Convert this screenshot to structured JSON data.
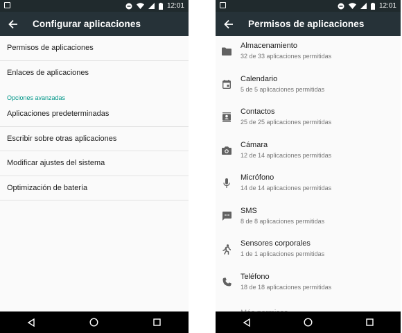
{
  "status": {
    "time": "12:01"
  },
  "left": {
    "title": "Configurar aplicaciones",
    "items_top": [
      {
        "label": "Permisos de aplicaciones"
      },
      {
        "label": "Enlaces de aplicaciones"
      }
    ],
    "section_header": "Opciones avanzadas",
    "items_adv": [
      {
        "label": "Aplicaciones predeterminadas"
      },
      {
        "label": "Escribir sobre otras aplicaciones"
      },
      {
        "label": "Modificar ajustes del sistema"
      },
      {
        "label": "Optimización de batería"
      }
    ]
  },
  "right": {
    "title": "Permisos de aplicaciones",
    "items": [
      {
        "name": "Almacenamiento",
        "sub": "32 de 33 aplicaciones permitidas",
        "icon": "folder-icon"
      },
      {
        "name": "Calendario",
        "sub": "5 de 5 aplicaciones permitidas",
        "icon": "calendar-icon"
      },
      {
        "name": "Contactos",
        "sub": "25 de 25 aplicaciones permitidas",
        "icon": "contacts-icon"
      },
      {
        "name": "Cámara",
        "sub": "12 de 14 aplicaciones permitidas",
        "icon": "camera-icon"
      },
      {
        "name": "Micrófono",
        "sub": "14 de 14 aplicaciones permitidas",
        "icon": "microphone-icon"
      },
      {
        "name": "SMS",
        "sub": "8 de 8 aplicaciones permitidas",
        "icon": "sms-icon"
      },
      {
        "name": "Sensores corporales",
        "sub": "1 de 1 aplicaciones permitidas",
        "icon": "body-sensor-icon"
      },
      {
        "name": "Teléfono",
        "sub": "18 de 18 aplicaciones permitidas",
        "icon": "phone-icon"
      }
    ],
    "partial_item": "Más permisos"
  },
  "colors": {
    "app_bar": "#263238",
    "status_bar": "#202a2d",
    "accent": "#009688",
    "nav_bar": "#000000"
  }
}
